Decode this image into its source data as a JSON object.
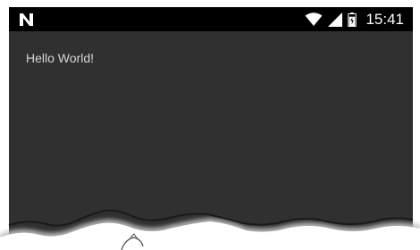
{
  "status_bar": {
    "notification_icon": "n-notification-icon",
    "wifi_icon": "wifi-icon",
    "signal_icon": "cell-signal-icon",
    "battery_icon": "battery-icon",
    "time": "15:41"
  },
  "main": {
    "text": "Hello World!"
  },
  "colors": {
    "status_bar": "#000000",
    "background": "#303030",
    "text": "#d6d6d6"
  }
}
